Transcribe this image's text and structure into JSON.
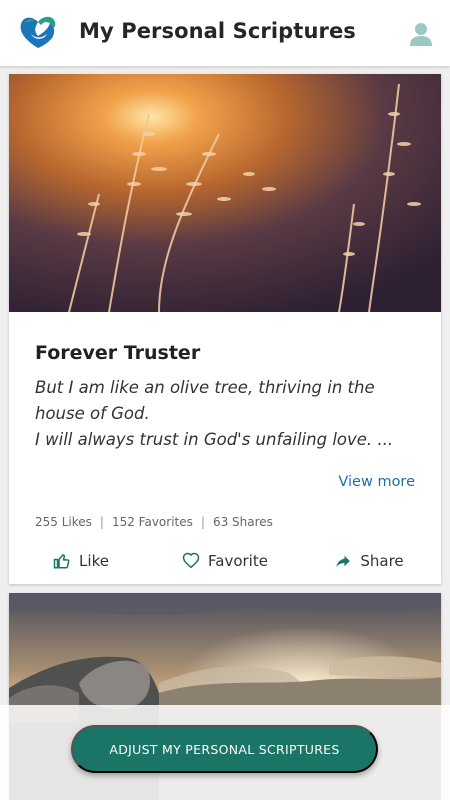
{
  "app_bar": {
    "title": "My Personal Scriptures",
    "logo_icon": "heart-dove-logo",
    "profile_icon": "user-avatar-icon"
  },
  "feed": {
    "cards": [
      {
        "image_alt": "Grass stems backlit by sunset",
        "title": "Forever Truster",
        "verse_lines": [
          "But I am like an olive tree, thriving in the house of God.",
          "I will always trust in God's unfailing love. ..."
        ],
        "view_more_label": "View more",
        "stats": {
          "likes": "255 Likes",
          "favorites": "152 Favorites",
          "shares": "63 Shares",
          "separator": "|"
        },
        "actions": {
          "like_label": "Like",
          "favorite_label": "Favorite",
          "share_label": "Share"
        }
      },
      {
        "image_alt": "Sunrise over mountains and rocks"
      }
    ]
  },
  "cta": {
    "label": "ADJUST MY PERSONAL SCRIPTURES"
  },
  "colors": {
    "accent": "#1a7566",
    "link": "#1e6fa8",
    "logo_blue": "#1e74b8",
    "logo_teal": "#2aa08a",
    "avatar": "#9cc7c2"
  }
}
